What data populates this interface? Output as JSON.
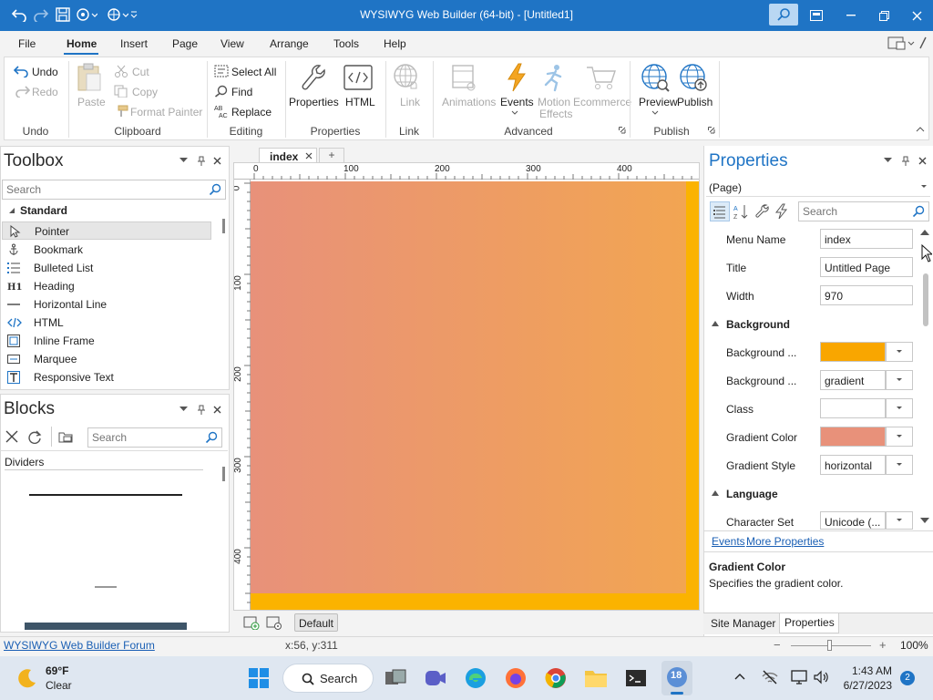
{
  "window": {
    "title": "WYSIWYG Web Builder (64-bit) - [Untitled1]"
  },
  "menu": {
    "items": [
      "File",
      "Home",
      "Insert",
      "Page",
      "View",
      "Arrange",
      "Tools",
      "Help"
    ]
  },
  "ribbon": {
    "undo": "Undo",
    "redo": "Redo",
    "paste": "Paste",
    "cut": "Cut",
    "copy": "Copy",
    "format_painter": "Format Painter",
    "select_all": "Select All",
    "find": "Find",
    "replace": "Replace",
    "properties": "Properties",
    "html": "HTML",
    "link": "Link",
    "animations": "Animations",
    "events": "Events",
    "motion_effects_1": "Motion",
    "motion_effects_2": "Effects",
    "ecommerce": "Ecommerce",
    "preview": "Preview",
    "publish": "Publish",
    "groups": {
      "undo": "Undo",
      "clipboard": "Clipboard",
      "editing": "Editing",
      "properties": "Properties",
      "link": "Link",
      "advanced": "Advanced",
      "publish": "Publish"
    }
  },
  "toolbox": {
    "title": "Toolbox",
    "search_placeholder": "Search",
    "category": "Standard",
    "items": [
      "Pointer",
      "Bookmark",
      "Bulleted List",
      "Heading",
      "Horizontal Line",
      "HTML",
      "Inline Frame",
      "Marquee",
      "Responsive Text"
    ]
  },
  "blocks": {
    "title": "Blocks",
    "search_placeholder": "Search",
    "category": "Dividers"
  },
  "document": {
    "tab_label": "index",
    "add_tab": "+",
    "ruler_h": [
      "0",
      "100",
      "200",
      "300",
      "400"
    ],
    "ruler_v": [
      "0",
      "100",
      "200",
      "300",
      "400"
    ],
    "default_button": "Default"
  },
  "properties": {
    "title": "Properties",
    "selector": "(Page)",
    "search_placeholder": "Search",
    "rows": {
      "menu_name": {
        "label": "Menu Name",
        "value": "index"
      },
      "title": {
        "label": "Title",
        "value": "Untitled Page"
      },
      "width": {
        "label": "Width",
        "value": "970"
      },
      "background_cat": "Background",
      "background_color": {
        "label": "Background ...",
        "color": "#f9a600"
      },
      "background_type": {
        "label": "Background ...",
        "value": "gradient"
      },
      "class": {
        "label": "Class",
        "value": ""
      },
      "gradient_color": {
        "label": "Gradient Color",
        "color": "#e8917a"
      },
      "gradient_style": {
        "label": "Gradient Style",
        "value": "horizontal"
      },
      "language_cat": "Language",
      "character_set": {
        "label": "Character Set",
        "value": "Unicode (..."
      }
    },
    "links": {
      "events": "Events",
      "more": "More Properties"
    },
    "help_title": "Gradient Color",
    "help_text": "Specifies the gradient color.",
    "bottom_tabs": [
      "Site Manager",
      "Properties"
    ]
  },
  "statusbar": {
    "forum_link": "WYSIWYG Web Builder Forum",
    "coords": "x:56, y:311",
    "zoom": "100%",
    "zoom_minus": "−",
    "zoom_plus": "+"
  },
  "taskbar": {
    "weather_temp": "69°F",
    "weather_desc": "Clear",
    "search_label": "Search",
    "time": "1:43 AM",
    "date": "6/27/2023",
    "notifications": "2",
    "app_badge": "18"
  },
  "colors": {
    "accent": "#1f74c5",
    "page_bg": "#fbb300",
    "gradient_start": "#e8917a",
    "gradient_end": "#f2a552"
  }
}
